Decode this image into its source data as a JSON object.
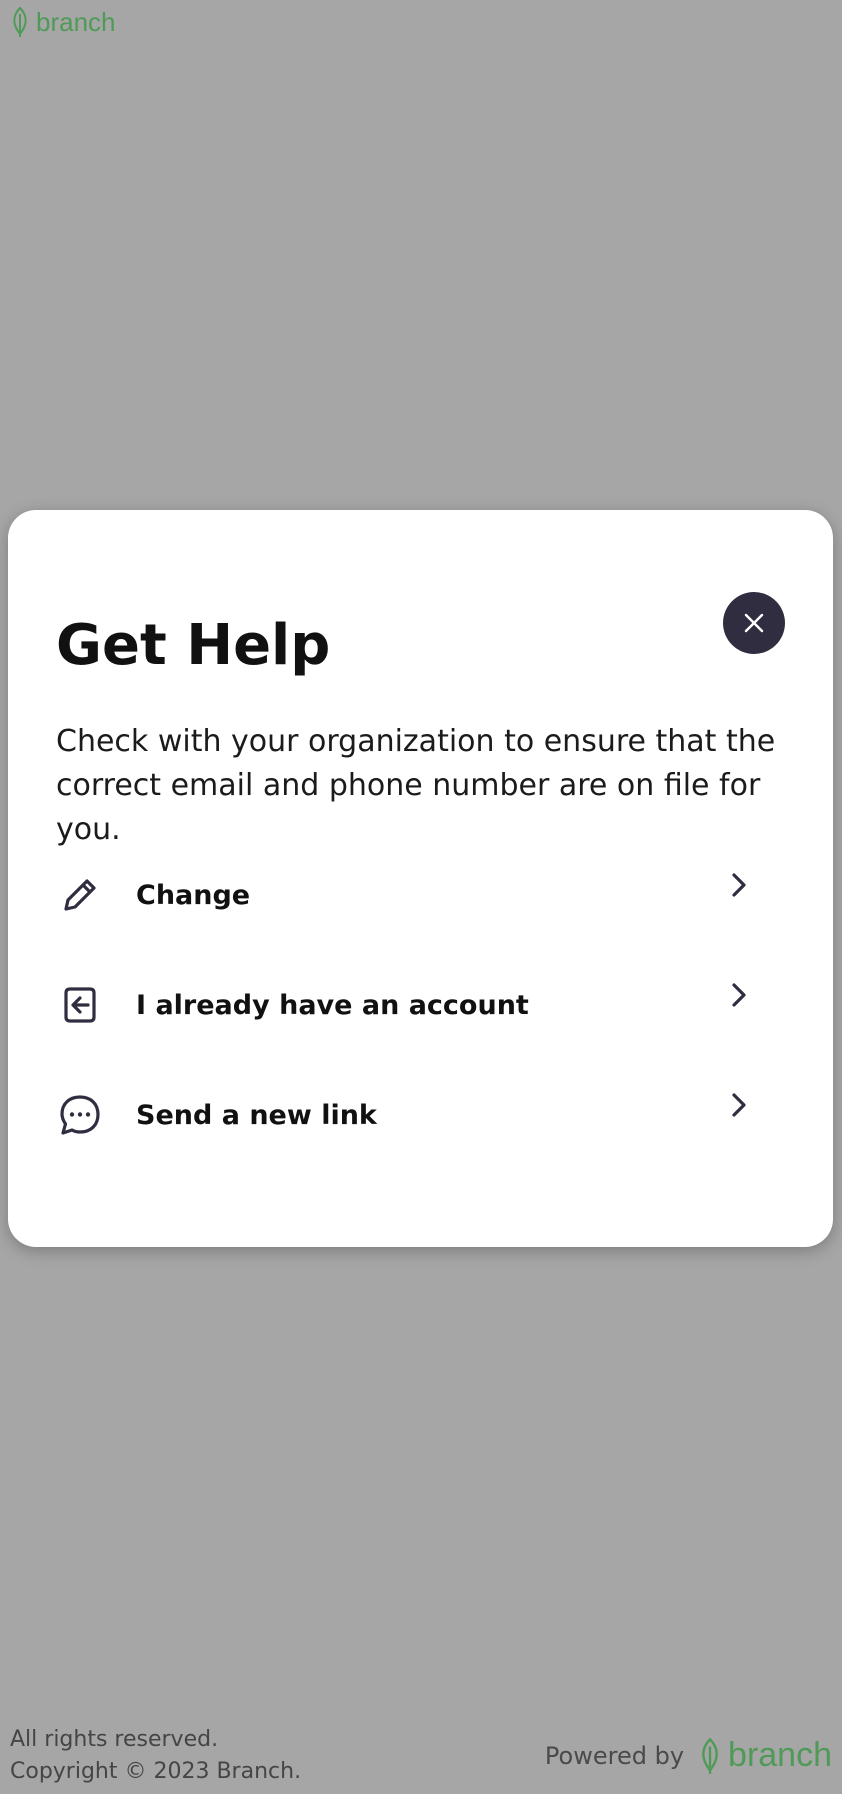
{
  "brand": {
    "name": "branch",
    "color": "#4f9a57",
    "logo_icon": "leaf-icon"
  },
  "modal": {
    "title": "Get Help",
    "description": "Check with your organization to ensure that the correct email and phone number are on file for you.",
    "close_icon": "close-icon",
    "options": [
      {
        "label": "Change",
        "icon": "pencil-icon"
      },
      {
        "label": "I already have an account",
        "icon": "sign-in-icon"
      },
      {
        "label": "Send a new link",
        "icon": "chat-bubble-icon"
      }
    ]
  },
  "footer": {
    "rights": "All rights reserved.",
    "copyright": "Copyright © 2023 Branch.",
    "powered_by": "Powered by",
    "brand_name": "branch"
  },
  "colors": {
    "backdrop": "#a6a6a6",
    "modal_bg": "#ffffff",
    "close_button_bg": "#2f2d3f",
    "text_dark": "#111111",
    "accent": "#4f9a57"
  }
}
